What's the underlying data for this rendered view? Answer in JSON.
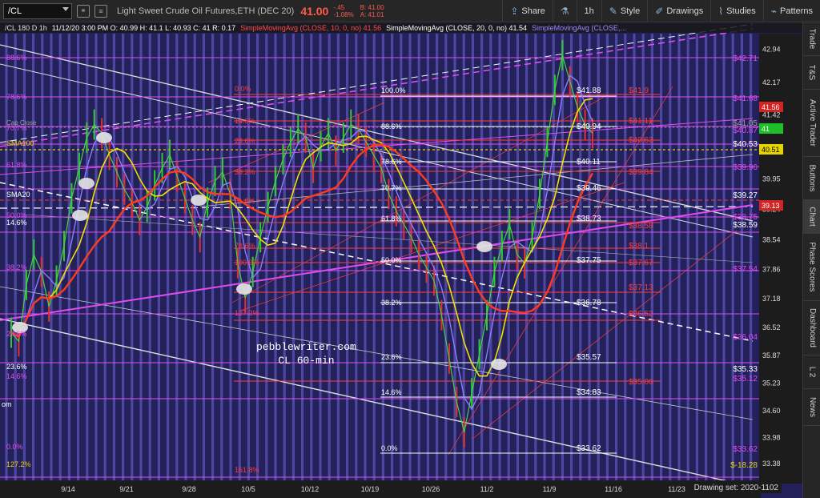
{
  "toolbar": {
    "symbol": "/CL",
    "title": "Light Sweet Crude Oil Futures,ETH (DEC 20)",
    "last_price": "41.00",
    "change": "-.45",
    "change_pct": "-1.08%",
    "bid": "B: 41.00",
    "ask": "A: 41.01",
    "share_label": "Share",
    "interval_label": "1h",
    "style_label": "Style",
    "drawings_label": "Drawings",
    "studies_label": "Studies",
    "patterns_label": "Patterns"
  },
  "chart_header": {
    "symbol_desc": "/CL 180 D 1h",
    "ohlc": "11/12/20 3:00 PM O: 40.99 H: 41.1 L: 40.93 C: 41 R: 0.17",
    "sma10": "SimpleMovingAvg (CLOSE, 10, 0, no) 41.56",
    "sma20": "SimpleMovingAvg (CLOSE, 20, 0, no) 41.54",
    "sma50": "SimpleMovingAvg (CLOSE,..."
  },
  "sidebar_tabs": [
    "Trade",
    "T&S",
    "Active Trader",
    "Buttons",
    "Chart",
    "Phase Scores",
    "Dashboard",
    "L 2",
    "News"
  ],
  "watermark": {
    "line1": "pebblewriter.com",
    "line2": "CL 60-min"
  },
  "drawing_set": "Drawing set: 2020-1102",
  "colors": {
    "chart_bg": "#23205a",
    "vgrid": "#6f68d8",
    "fib_magenta": "#e24bf0",
    "fib_red": "#ff3b3b",
    "price_tag_red": "#d32424",
    "price_tag_green": "#1fbf2a",
    "price_tag_yellow": "#e6d400",
    "sma10": "#ff3b1f",
    "sma20": "#f0e000",
    "sma50": "#8c7dff"
  },
  "chart_data": {
    "type": "line",
    "ylim": [
      33.1,
      43.3
    ],
    "y_ticks": [
      42.94,
      42.17,
      41.42,
      40.68,
      39.95,
      39.24,
      38.54,
      37.86,
      37.18,
      36.52,
      35.87,
      35.23,
      34.6,
      33.98,
      33.38
    ],
    "x_ticks": [
      "9/14",
      "9/21",
      "9/28",
      "10/5",
      "10/12",
      "10/19",
      "10/26",
      "11/2",
      "11/9",
      "11/16",
      "11/23",
      "11/30"
    ],
    "price_tags": [
      {
        "value": "41.56",
        "color": "red"
      },
      {
        "value": "41",
        "color": "green"
      },
      {
        "value": "40.51",
        "color": "yellow"
      },
      {
        "value": "39.13",
        "color": "red"
      }
    ],
    "right_level_labels": [
      {
        "text": "$42.71",
        "color": "magenta"
      },
      {
        "text": "$41.68",
        "color": "magenta"
      },
      {
        "text": "$41.05",
        "color": "grey"
      },
      {
        "text": "$40.87",
        "color": "magenta"
      },
      {
        "text": "$40.53",
        "color": "white"
      },
      {
        "text": "$39.96",
        "color": "magenta"
      },
      {
        "text": "$39.27",
        "color": "white"
      },
      {
        "text": "$38.75",
        "color": "magenta"
      },
      {
        "text": "$38.59",
        "color": "white"
      },
      {
        "text": "$37.54",
        "color": "magenta"
      },
      {
        "text": "$36.04",
        "color": "magenta"
      },
      {
        "text": "$35.33",
        "color": "white"
      },
      {
        "text": "$35.12",
        "color": "magenta"
      },
      {
        "text": "$33.62",
        "color": "magenta"
      },
      {
        "text": "$-18.28",
        "color": "yellow"
      }
    ],
    "left_fib_labels": [
      "88.6%",
      "78.6%",
      "70.7%",
      "61.8%",
      "50.0%",
      "38.2%",
      "23.6%",
      "23.6%",
      "14.6%",
      "0.0%",
      "127.2%",
      "14.6%"
    ],
    "left_fib_text": [
      "Cap Close",
      "SMA100",
      "SMA20",
      "om"
    ],
    "mid_red_fib_labels": [
      "0.0%",
      "14.6%",
      "23.6%",
      "38.2%",
      "61.8%",
      "78.6%",
      "100.0%",
      "127.2%",
      "161.8%"
    ],
    "center_fib_labels": [
      "100.0%",
      "88.6%",
      "78.6%",
      "70.7%",
      "61.8%",
      "50.0%",
      "38.2%",
      "23.6%",
      "14.6%",
      "0.0%"
    ],
    "center_fib_values": [
      "$41.88",
      "$40.94",
      "$40.11",
      "$39.46",
      "$38.73",
      "$37.75",
      "$36.78",
      "$35.57",
      "$34.83",
      "$33.62"
    ],
    "red_fib_values": [
      "$41.9",
      "$41.11",
      "$40.63",
      "$39.84",
      "$38.58",
      "$38.1",
      "$37.67",
      "$37.13",
      "$36.52",
      "$35.06"
    ],
    "price_series": [
      36.4,
      36.2,
      37.5,
      38.2,
      37.8,
      37.0,
      37.6,
      38.4,
      39.5,
      40.2,
      40.9,
      41.2,
      41.0,
      40.5,
      40.1,
      39.7,
      39.4,
      39.0,
      39.3,
      39.8,
      40.2,
      40.5,
      40.0,
      39.5,
      39.0,
      38.6,
      39.4,
      39.9,
      40.1,
      39.6,
      38.0,
      37.2,
      37.8,
      38.6,
      39.3,
      39.9,
      40.4,
      40.8,
      41.1,
      40.9,
      40.2,
      40.7,
      41.0,
      40.6,
      40.9,
      41.2,
      41.1,
      40.8,
      40.5,
      40.2,
      39.6,
      39.2,
      38.9,
      38.6,
      38.2,
      37.9,
      37.6,
      36.8,
      35.8,
      34.8,
      34.1,
      35.0,
      35.9,
      36.8,
      37.8,
      38.4,
      38.9,
      38.2,
      38.0,
      38.6,
      39.6,
      40.8,
      42.0,
      42.8,
      42.2,
      41.6,
      41.2,
      41.0
    ]
  }
}
